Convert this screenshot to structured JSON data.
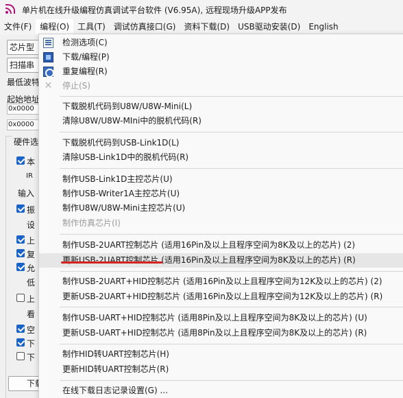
{
  "window": {
    "title": "单片机在线升级编程仿真调试平台软件 (V6.95A), 远程现场升级APP发布"
  },
  "menubar": [
    "文件(F)",
    "编程(O)",
    "工具(T)",
    "调试仿真接口(G)",
    "资料下载(D)",
    "USB驱动安装(D)",
    "English"
  ],
  "left_panel": {
    "chip_button": "芯片型",
    "scan_button": "扫描串",
    "min_baud_label": "最低波特",
    "start_addr_label": "起始地址",
    "addr1": "0x0000",
    "addr2": "0x0000",
    "hw_group_label": "硬件选",
    "row1": "本",
    "row2": "IR",
    "row3": "输入",
    "row4": "振",
    "row5": "设",
    "row6": "上",
    "row7": "复",
    "row8": "允",
    "row9": "低",
    "row10": "上",
    "row11": "看",
    "row12": "空",
    "row13": "下",
    "row14": "下",
    "download_button": "下载"
  },
  "menu": {
    "items": [
      {
        "label": "检测选项(C)",
        "icon": "list-icon"
      },
      {
        "label": "下载/编程(P)",
        "icon": "chip-icon"
      },
      {
        "label": "重复编程(R)",
        "icon": "repeat-icon"
      },
      {
        "label": "停止(S)",
        "icon": "stop-icon"
      },
      {
        "label": "下载脱机代码到U8W/U8W-Mini(L)"
      },
      {
        "label": "清除U8W/U8W-MIni中的脱机代码(R)"
      },
      {
        "label": "下载脱机代码到USB-Link1D(L)"
      },
      {
        "label": "清除USB-Link1D中的脱机代码(R)"
      },
      {
        "label": "制作USB-Link1D主控芯片(U)"
      },
      {
        "label": "制作USB-Writer1A主控芯片(U)"
      },
      {
        "label": "制作U8W/U8W-Mini主控芯片(U)"
      },
      {
        "label": "制作仿真芯片(I)"
      },
      {
        "label": "制作USB-2UART控制芯片 (适用16Pin及以上且程序空间为8K及以上的芯片) (2)"
      },
      {
        "label": "更新USB-2UART控制芯片 (适用16Pin及以上且程序空间为8K及以上的芯片) (R)"
      },
      {
        "label": "制作USB-2UART+HID控制芯片 (适用16Pin及以上且程序空间为12K及以上的芯片) (2)"
      },
      {
        "label": "更新USB-2UART+HID控制芯片 (适用16Pin及以上且程序空间为12K及以上的芯片) (R)"
      },
      {
        "label": "制作USB-UART+HID控制芯片 (适用8Pin及以上且程序空间为8K及以上的芯片) (U)"
      },
      {
        "label": "更新USB-UART+HID控制芯片 (适用8Pin及以上且程序空间为8K及以上的芯片) (R)"
      },
      {
        "label": "制作HID转UART控制芯片(H)"
      },
      {
        "label": "更新HID转UART控制芯片(R)"
      },
      {
        "label": "在线下载日志记录设置(G) ..."
      }
    ]
  },
  "colors": {
    "highlight_underline": "#d32020",
    "checkbox_checked": "#1a64c8",
    "app_icon": "#b0107a"
  }
}
